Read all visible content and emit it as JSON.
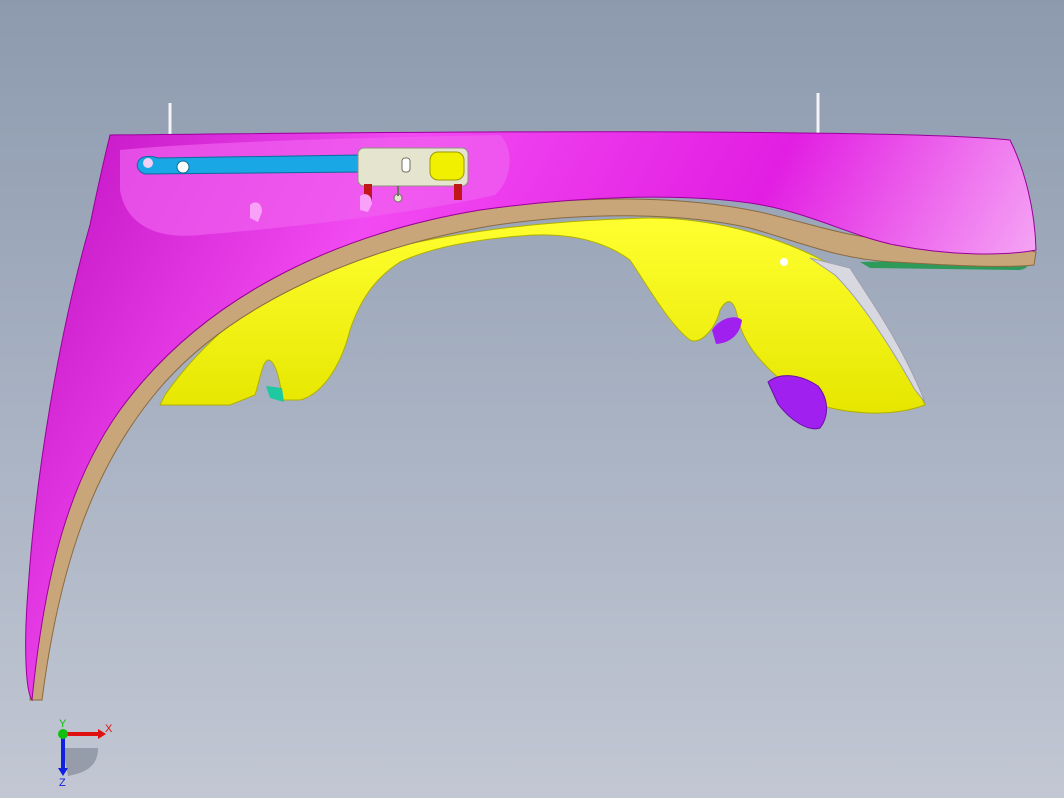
{
  "viewport": {
    "colors": {
      "background_top": "#8d9aae",
      "background_bottom": "#c2c7d3",
      "fender_body": "#e61ee6",
      "fender_edge": "#c9a67a",
      "inner_liner": "#f5f500",
      "bracket_bar": "#1aa7e6",
      "clip": "#e4e4cf",
      "fastener_red": "#c01818",
      "purple_part": "#a020f0",
      "teal_part": "#1ec8a0",
      "green_strip": "#2e9a5a"
    }
  },
  "triad": {
    "x_label": "X",
    "y_label": "Y",
    "z_label": "Z",
    "x_color": "#e01010",
    "y_color": "#10c010",
    "z_color": "#1020e0"
  }
}
